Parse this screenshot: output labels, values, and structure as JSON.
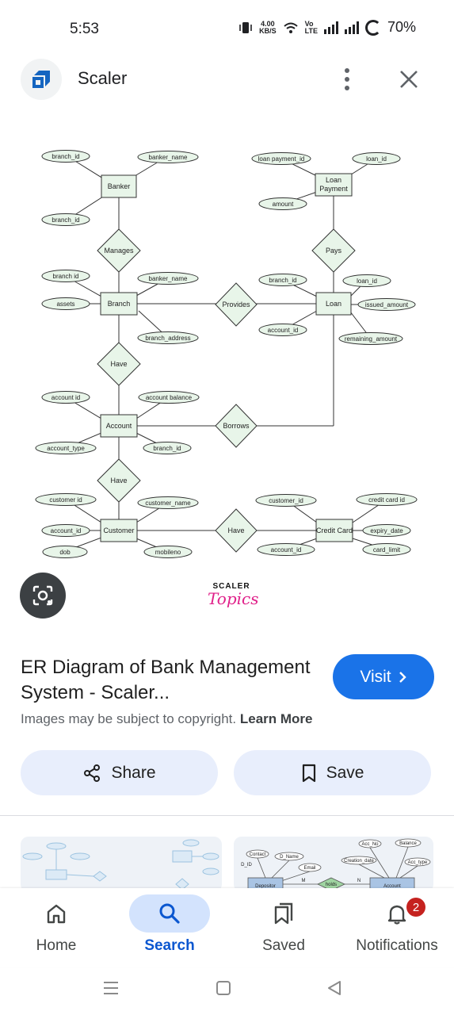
{
  "status_bar": {
    "time": "5:53",
    "speed_value": "4.00",
    "speed_unit": "KB/S",
    "volte_top": "Vo",
    "volte_bottom": "LTE",
    "battery": "70%"
  },
  "header": {
    "site_name": "Scaler"
  },
  "diagram": {
    "entities": {
      "banker": "Banker",
      "loan_payment": "Loan Payment",
      "branch": "Branch",
      "loan": "Loan",
      "account": "Account",
      "customer": "Customer",
      "credit_card": "Credit Card"
    },
    "relationships": {
      "manages": "Manages",
      "pays": "Pays",
      "provides": "Provides",
      "have1": "Have",
      "borrows": "Borrows",
      "have2": "Have",
      "have3": "Have"
    },
    "attributes": {
      "banker_branch_id": "branch_id",
      "banker_name": "banker_name",
      "banker_branch_id2": "branch_id",
      "lp_loan_payment_id": "loan payment_id",
      "lp_loan_id": "loan_id",
      "lp_amount": "amount",
      "br_branch_id": "branch id",
      "br_assets": "assets",
      "br_banker_name": "banker_name",
      "br_address": "branch_address",
      "ln_branch_id": "branch_id",
      "ln_account_id": "account_id",
      "ln_loan_id": "loan_id",
      "ln_issued": "issued_amount",
      "ln_remaining": "remaining_amount",
      "ac_account_id": "account id",
      "ac_type": "account_type",
      "ac_balance": "account balance",
      "ac_branch_id": "branch_id",
      "cu_customer_id": "customer id",
      "cu_account_id": "account_id",
      "cu_dob": "dob",
      "cu_name": "customer_name",
      "cu_mobile": "mobileno",
      "cc_customer_id": "customer_id",
      "cc_account_id": "account_id",
      "cc_card_id": "credit card id",
      "cc_expiry": "expiry_date",
      "cc_limit": "card_limit"
    }
  },
  "watermark": {
    "top": "SCALER",
    "bottom": "Topics"
  },
  "result": {
    "title": "ER Diagram of Bank Management System - Scaler...",
    "visit_label": "Visit",
    "copyright_text": "Images may be subject to copyright.",
    "learn_more": "Learn More",
    "share_label": "Share",
    "save_label": "Save"
  },
  "related": {
    "thumb2_labels": {
      "contact": "Contact",
      "d_name": "D_Name",
      "d_id": "D_ID",
      "email": "Email",
      "creation_date": "Creation_date",
      "acc_no": "Acc_No",
      "balance": "Balance",
      "acc_type": "Acc_type",
      "depositor": "Depositor",
      "holds": "holds",
      "account": "Account",
      "m": "M",
      "n": "N"
    }
  },
  "bottom_nav": {
    "home": "Home",
    "search": "Search",
    "saved": "Saved",
    "notifications": "Notifications",
    "notification_count": "2"
  },
  "colors": {
    "accent": "#1a73e8",
    "active_tab": "#0b57d0",
    "pill": "#d3e3fd",
    "button_bg": "#e8eefc",
    "entity_fill": "#e8f5e9",
    "badge": "#c5221f",
    "watermark_pink": "#e0218a"
  }
}
